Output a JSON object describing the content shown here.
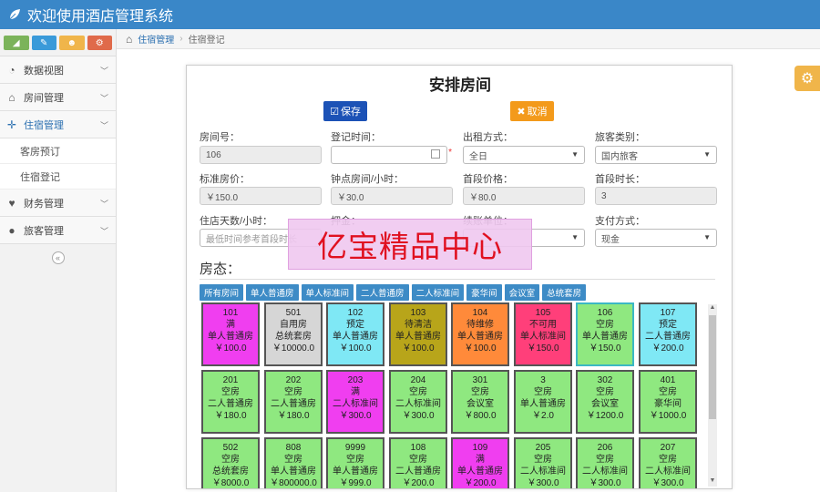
{
  "app": {
    "title": "欢迎使用酒店管理系统"
  },
  "sidebar": {
    "shortcuts": [
      {
        "icon": "signal-icon",
        "color": "#7bb35a"
      },
      {
        "icon": "pencil-icon",
        "color": "#3a9ad9"
      },
      {
        "icon": "users-icon",
        "color": "#f0b54a"
      },
      {
        "icon": "cogs-icon",
        "color": "#e06a4a"
      }
    ],
    "items": [
      {
        "label": "数据视图",
        "icon": "dashboard-icon"
      },
      {
        "label": "房间管理",
        "icon": "home-icon"
      },
      {
        "label": "住宿管理",
        "icon": "move-icon"
      },
      {
        "label": "财务管理",
        "icon": "heart-icon"
      },
      {
        "label": "旅客管理",
        "icon": "user-icon"
      }
    ],
    "sub_items": [
      "客房预订",
      "住宿登记"
    ],
    "collapse_label": "«"
  },
  "breadcrumb": {
    "parent": "住宿管理",
    "current": "住宿登记"
  },
  "form": {
    "title": "安排房间",
    "save_label": "保存",
    "cancel_label": "取消",
    "fields": {
      "room_no": {
        "label": "房间号：",
        "value": "106"
      },
      "register_time": {
        "label": "登记时间：",
        "value": ""
      },
      "rent_mode": {
        "label": "出租方式：",
        "value": "全日"
      },
      "guest_type": {
        "label": "旅客类别：",
        "value": "国内旅客"
      },
      "std_price": {
        "label": "标准房价：",
        "value": "￥150.0"
      },
      "hourly_price": {
        "label": "钟点房间/小时：",
        "value": "￥30.0"
      },
      "first_price": {
        "label": "首段价格：",
        "value": "￥80.0"
      },
      "first_duration": {
        "label": "首段时长：",
        "value": "3"
      },
      "stay_days": {
        "label": "住店天数/小时：",
        "placeholder": "最低时间参考首段时长"
      },
      "deposit": {
        "label": "押金："
      },
      "renew_unit": {
        "label": "续账单位："
      },
      "pay_method": {
        "label": "支付方式：",
        "value": "现金"
      }
    },
    "room_status_label": "房态："
  },
  "tabs": [
    "所有房间",
    "单人普通房",
    "单人标准间",
    "二人普通房",
    "二人标准间",
    "豪华间",
    "会议室",
    "总统套房"
  ],
  "rooms": [
    {
      "no": "101",
      "status": "满",
      "type": "单人普通房",
      "price": "￥100.0",
      "color": "#f03ef0"
    },
    {
      "no": "501",
      "status": "自用房",
      "type": "总统套房",
      "price": "￥10000.0",
      "color": "#d6d6d6"
    },
    {
      "no": "102",
      "status": "预定",
      "type": "单人普通房",
      "price": "￥100.0",
      "color": "#7fe8f5"
    },
    {
      "no": "103",
      "status": "待清洁",
      "type": "单人普通房",
      "price": "￥100.0",
      "color": "#b8a51a"
    },
    {
      "no": "104",
      "status": "待维修",
      "type": "单人普通房",
      "price": "￥100.0",
      "color": "#ff8a3a"
    },
    {
      "no": "105",
      "status": "不可用",
      "type": "单人标准间",
      "price": "￥150.0",
      "color": "#ff3f7a"
    },
    {
      "no": "106",
      "status": "空房",
      "type": "单人普通房",
      "price": "￥150.0",
      "color": "#8fe880",
      "selected": true
    },
    {
      "no": "107",
      "status": "预定",
      "type": "二人普通房",
      "price": "￥200.0",
      "color": "#7fe8f5"
    },
    {
      "no": "201",
      "status": "空房",
      "type": "二人普通房",
      "price": "￥180.0",
      "color": "#8fe880"
    },
    {
      "no": "202",
      "status": "空房",
      "type": "二人普通房",
      "price": "￥180.0",
      "color": "#8fe880"
    },
    {
      "no": "203",
      "status": "满",
      "type": "二人标准间",
      "price": "￥300.0",
      "color": "#f03ef0"
    },
    {
      "no": "204",
      "status": "空房",
      "type": "二人标准间",
      "price": "￥300.0",
      "color": "#8fe880"
    },
    {
      "no": "301",
      "status": "空房",
      "type": "会议室",
      "price": "￥800.0",
      "color": "#8fe880"
    },
    {
      "no": "3",
      "status": "空房",
      "type": "单人普通房",
      "price": "￥2.0",
      "color": "#8fe880"
    },
    {
      "no": "302",
      "status": "空房",
      "type": "会议室",
      "price": "￥1200.0",
      "color": "#8fe880"
    },
    {
      "no": "401",
      "status": "空房",
      "type": "豪华间",
      "price": "￥1000.0",
      "color": "#8fe880"
    },
    {
      "no": "502",
      "status": "空房",
      "type": "总统套房",
      "price": "￥8000.0",
      "color": "#8fe880"
    },
    {
      "no": "808",
      "status": "空房",
      "type": "单人普通房",
      "price": "￥800000.0",
      "color": "#8fe880"
    },
    {
      "no": "9999",
      "status": "空房",
      "type": "单人普通房",
      "price": "￥999.0",
      "color": "#8fe880"
    },
    {
      "no": "108",
      "status": "空房",
      "type": "二人普通房",
      "price": "￥200.0",
      "color": "#8fe880"
    },
    {
      "no": "109",
      "status": "满",
      "type": "单人普通房",
      "price": "￥200.0",
      "color": "#f03ef0"
    },
    {
      "no": "205",
      "status": "空房",
      "type": "二人标准间",
      "price": "￥300.0",
      "color": "#8fe880"
    },
    {
      "no": "206",
      "status": "空房",
      "type": "二人标准间",
      "price": "￥300.0",
      "color": "#8fe880"
    },
    {
      "no": "207",
      "status": "空房",
      "type": "二人标准间",
      "price": "￥300.0",
      "color": "#8fe880"
    }
  ],
  "watermark": "亿宝精品中心"
}
